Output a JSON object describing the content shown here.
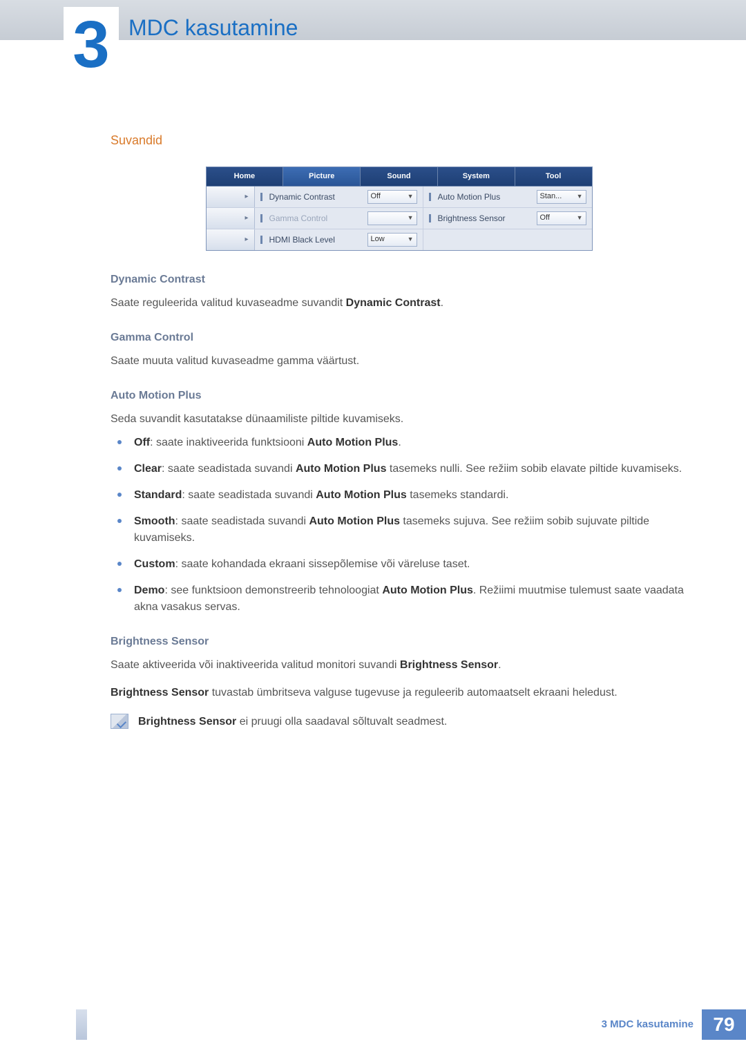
{
  "chapter": {
    "number": "3",
    "title": "MDC kasutamine"
  },
  "section": {
    "title": "Suvandid"
  },
  "ui": {
    "tabs": [
      "Home",
      "Picture",
      "Sound",
      "System",
      "Tool"
    ],
    "activeTabIndex": 1,
    "rows": [
      {
        "left": {
          "label": "Dynamic Contrast",
          "value": "Off",
          "disabled": false
        },
        "right": {
          "label": "Auto Motion Plus",
          "value": "Stan...",
          "disabled": false
        }
      },
      {
        "left": {
          "label": "Gamma Control",
          "value": "",
          "disabled": true
        },
        "right": {
          "label": "Brightness Sensor",
          "value": "Off",
          "disabled": false
        }
      },
      {
        "left": {
          "label": "HDMI Black Level",
          "value": "Low",
          "disabled": false
        },
        "right": null
      }
    ],
    "rowbtn_glyph": "▸"
  },
  "sections": {
    "dynamic_contrast": {
      "heading": "Dynamic Contrast",
      "text_pre": "Saate reguleerida valitud kuvaseadme suvandit ",
      "text_bold": "Dynamic Contrast",
      "text_post": "."
    },
    "gamma_control": {
      "heading": "Gamma Control",
      "text": "Saate muuta valitud kuvaseadme gamma väärtust."
    },
    "auto_motion_plus": {
      "heading": "Auto Motion Plus",
      "intro": "Seda suvandit kasutatakse dünaamiliste piltide kuvamiseks.",
      "items": [
        {
          "lead": "Off",
          "rest": ": saate inaktiveerida funktsiooni ",
          "bold2": "Auto Motion Plus",
          "tail": "."
        },
        {
          "lead": "Clear",
          "rest": ": saate seadistada suvandi ",
          "bold2": "Auto Motion Plus",
          "tail": " tasemeks nulli. See režiim sobib elavate piltide kuvamiseks."
        },
        {
          "lead": "Standard",
          "rest": ": saate seadistada suvandi ",
          "bold2": "Auto Motion Plus",
          "tail": " tasemeks standardi."
        },
        {
          "lead": "Smooth",
          "rest": ": saate seadistada suvandi ",
          "bold2": "Auto Motion Plus",
          "tail": " tasemeks sujuva. See režiim sobib sujuvate piltide kuvamiseks."
        },
        {
          "lead": "Custom",
          "rest": ": saate kohandada ekraani sissepõlemise või väreluse taset.",
          "bold2": "",
          "tail": ""
        },
        {
          "lead": "Demo",
          "rest": ": see funktsioon demonstreerib tehnoloogiat ",
          "bold2": "Auto Motion Plus",
          "tail": ". Režiimi muutmise tulemust saate vaadata akna vasakus servas."
        }
      ]
    },
    "brightness_sensor": {
      "heading": "Brightness Sensor",
      "p1_pre": "Saate aktiveerida või inaktiveerida valitud monitori suvandi ",
      "p1_bold": "Brightness Sensor",
      "p1_post": ".",
      "p2_bold": "Brightness Sensor",
      "p2_rest": " tuvastab ümbritseva valguse tugevuse ja reguleerib automaatselt ekraani heledust.",
      "note_bold": "Brightness Sensor",
      "note_rest": " ei pruugi olla saadaval sõltuvalt seadmest."
    }
  },
  "footer": {
    "text": "3 MDC kasutamine",
    "page": "79"
  }
}
